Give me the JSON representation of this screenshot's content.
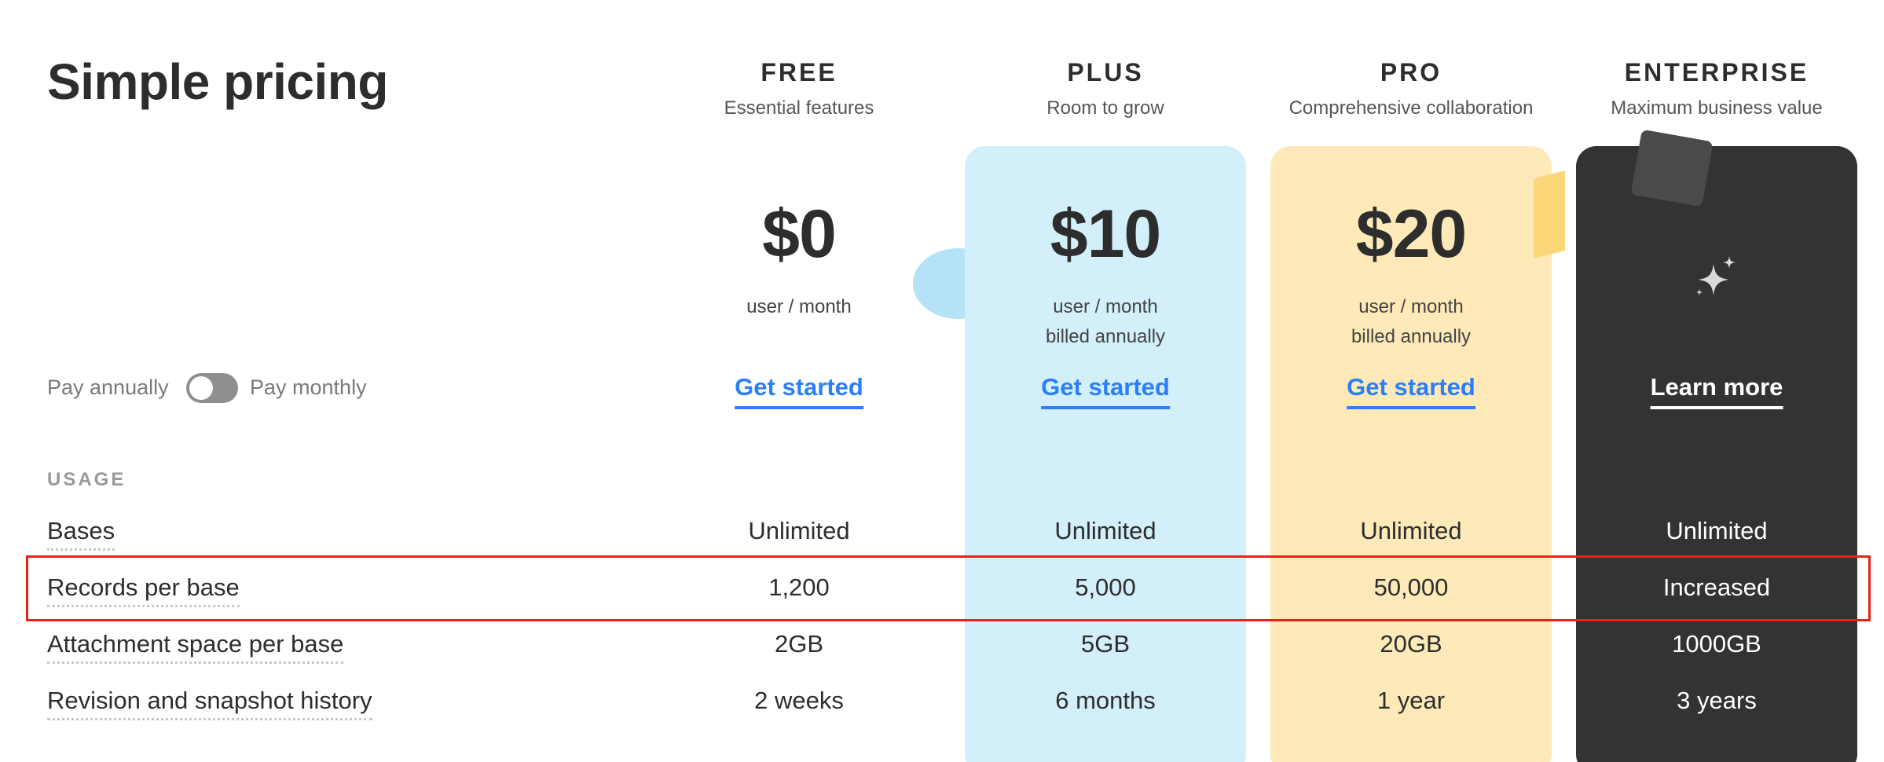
{
  "page": {
    "title": "Simple pricing"
  },
  "plans": [
    {
      "name": "FREE",
      "subtitle": "Essential features",
      "price": "$0",
      "price_note_1": "user / month",
      "price_note_2": "",
      "cta": "Get started"
    },
    {
      "name": "PLUS",
      "subtitle": "Room to grow",
      "price": "$10",
      "price_note_1": "user / month",
      "price_note_2": "billed annually",
      "cta": "Get started"
    },
    {
      "name": "PRO",
      "subtitle": "Comprehensive collaboration",
      "price": "$20",
      "price_note_1": "user / month",
      "price_note_2": "billed annually",
      "cta": "Get started"
    },
    {
      "name": "ENTERPRISE",
      "subtitle": "Maximum business value",
      "icon": "sparkle-icon",
      "cta": "Learn more"
    }
  ],
  "billing_toggle": {
    "left_label": "Pay annually",
    "right_label": "Pay monthly",
    "state": "annually"
  },
  "usage": {
    "section_label": "USAGE",
    "rows": [
      {
        "label": "Bases",
        "values": [
          "Unlimited",
          "Unlimited",
          "Unlimited",
          "Unlimited"
        ]
      },
      {
        "label": "Records per base",
        "values": [
          "1,200",
          "5,000",
          "50,000",
          "Increased"
        ],
        "highlighted": true
      },
      {
        "label": "Attachment space per base",
        "values": [
          "2GB",
          "5GB",
          "20GB",
          "1000GB"
        ]
      },
      {
        "label": "Revision and snapshot history",
        "values": [
          "2 weeks",
          "6 months",
          "1 year",
          "3 years"
        ]
      }
    ]
  },
  "colors": {
    "plus_card": "#d2effa",
    "pro_card": "#fdeab8",
    "enterprise_card": "#333333",
    "cta_link": "#2d7ff9",
    "highlight_box": "#e0261b"
  }
}
